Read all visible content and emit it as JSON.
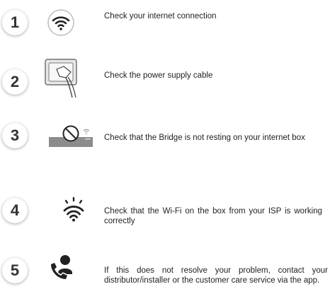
{
  "steps": [
    {
      "number": "1",
      "icon": "wifi-icon",
      "text": "Check your internet connection"
    },
    {
      "number": "2",
      "icon": "power-plug-icon",
      "text": "Check the power supply cable"
    },
    {
      "number": "3",
      "icon": "bridge-on-box-icon",
      "text": "Check that the Bridge is not resting on your internet box"
    },
    {
      "number": "4",
      "icon": "wifi-signal-icon",
      "text": "Check that the Wi-Fi on the box from your ISP is working correctly"
    },
    {
      "number": "5",
      "icon": "phone-contact-icon",
      "text": "If this does not resolve your problem, contact your distributor/installer or the customer care service via the app."
    }
  ]
}
